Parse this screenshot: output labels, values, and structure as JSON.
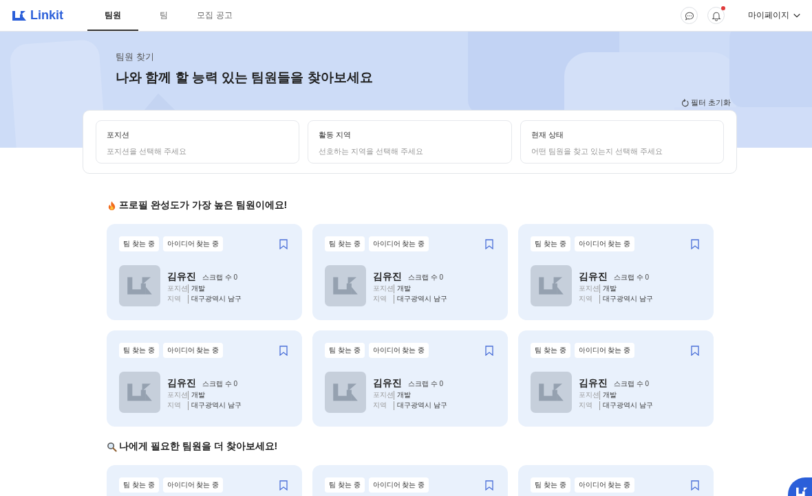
{
  "header": {
    "logo": "Linkit",
    "nav": [
      {
        "label": "팀원",
        "selected": true
      },
      {
        "label": "팀",
        "selected": false
      },
      {
        "label": "모집 공고",
        "selected": false
      }
    ],
    "notifications": {
      "unread": true
    },
    "mypage": "마이페이지"
  },
  "hero": {
    "subtitle": "팀원 찾기",
    "title": "나와 함께 할 능력 있는 팀원들을 찾아보세요",
    "reset": "필터 초기화"
  },
  "filters": [
    {
      "label": "포지션",
      "placeholder": "포지션을 선택해 주세요"
    },
    {
      "label": "활동 지역",
      "placeholder": "선호하는 지역을 선택해 주세요"
    },
    {
      "label": "현재 상태",
      "placeholder": "어떤 팀원을 찾고 있는지 선택해 주세요"
    }
  ],
  "sections": [
    {
      "heading": "프로필 완성도가 가장 높은 팀원이에요!",
      "cards": [
        {
          "tags": [
            "팀 찾는 중",
            "아이디어 찾는 중"
          ],
          "bookmarked": false,
          "name": "김유진",
          "scraps": "스크랩 수 0",
          "position_label": "포지션",
          "position": "개발",
          "region_label": "지역",
          "region": "대구광역시 남구"
        },
        {
          "tags": [
            "팀 찾는 중",
            "아이디어 찾는 중"
          ],
          "bookmarked": false,
          "name": "김유진",
          "scraps": "스크랩 수 0",
          "position_label": "포지션",
          "position": "개발",
          "region_label": "지역",
          "region": "대구광역시 남구"
        },
        {
          "tags": [
            "팀 찾는 중",
            "아이디어 찾는 중"
          ],
          "bookmarked": false,
          "name": "김유진",
          "scraps": "스크랩 수 0",
          "position_label": "포지션",
          "position": "개발",
          "region_label": "지역",
          "region": "대구광역시 남구"
        },
        {
          "tags": [
            "팀 찾는 중",
            "아이디어 찾는 중"
          ],
          "bookmarked": false,
          "name": "김유진",
          "scraps": "스크랩 수 0",
          "position_label": "포지션",
          "position": "개발",
          "region_label": "지역",
          "region": "대구광역시 남구"
        },
        {
          "tags": [
            "팀 찾는 중",
            "아이디어 찾는 중"
          ],
          "bookmarked": false,
          "name": "김유진",
          "scraps": "스크랩 수 0",
          "position_label": "포지션",
          "position": "개발",
          "region_label": "지역",
          "region": "대구광역시 남구"
        },
        {
          "tags": [
            "팀 찾는 중",
            "아이디어 찾는 중"
          ],
          "bookmarked": false,
          "name": "김유진",
          "scraps": "스크랩 수 0",
          "position_label": "포지션",
          "position": "개발",
          "region_label": "지역",
          "region": "대구광역시 남구"
        }
      ]
    },
    {
      "heading": "나에게 필요한 팀원을 더 찾아보세요!",
      "cards": [
        {
          "tags": [
            "팀 찾는 중",
            "아이디어 찾는 중"
          ],
          "bookmarked": false
        },
        {
          "tags": [
            "팀 찾는 중",
            "아이디어 찾는 중"
          ],
          "bookmarked": false
        },
        {
          "tags": [
            "팀 찾는 중",
            "아이디어 찾는 중"
          ],
          "bookmarked": false
        }
      ]
    }
  ]
}
